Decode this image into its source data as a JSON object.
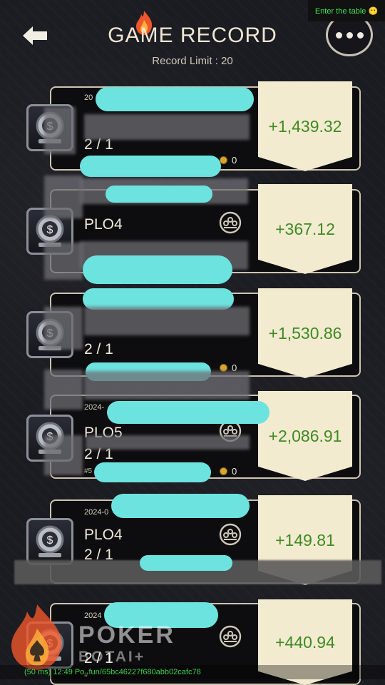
{
  "header": {
    "title": "GAME RECORD",
    "subtitle": "Record Limit : 20",
    "enter_table": "Enter the table 😶"
  },
  "records": [
    {
      "date": "20",
      "game": "",
      "stakes": "2 / 1",
      "meta": "",
      "coins": "0",
      "profit": "+1,439.32"
    },
    {
      "date": "",
      "game": "PLO4",
      "stakes": "",
      "meta": "",
      "coins": "",
      "profit": "+367.12"
    },
    {
      "date": "",
      "game": "",
      "stakes": "2 / 1",
      "meta": "",
      "coins": "0",
      "profit": "+1,530.86"
    },
    {
      "date": "2024-",
      "game": "PLO5",
      "stakes": "2 / 1",
      "meta": "#5",
      "coins": "0",
      "profit": "+2,086.91"
    },
    {
      "date": "2024-0",
      "game": "PLO4",
      "stakes": "2 / 1",
      "meta": "",
      "coins": "",
      "profit": "+149.81"
    },
    {
      "date": "2024",
      "game": "",
      "stakes": "2 / 1",
      "meta": "#",
      "coins": "",
      "profit": "+440.94"
    }
  ],
  "watermark": {
    "line1": "POKER",
    "line2": "BOTAI+"
  },
  "debug": {
    "text": "(50 ms) 12:49 Po                  .fun/65bc46227f680abb02cafc78"
  },
  "colors": {
    "profit_green": "#3f8a26",
    "tag_bg": "#f3ebcf",
    "redaction": "#6de3df"
  }
}
